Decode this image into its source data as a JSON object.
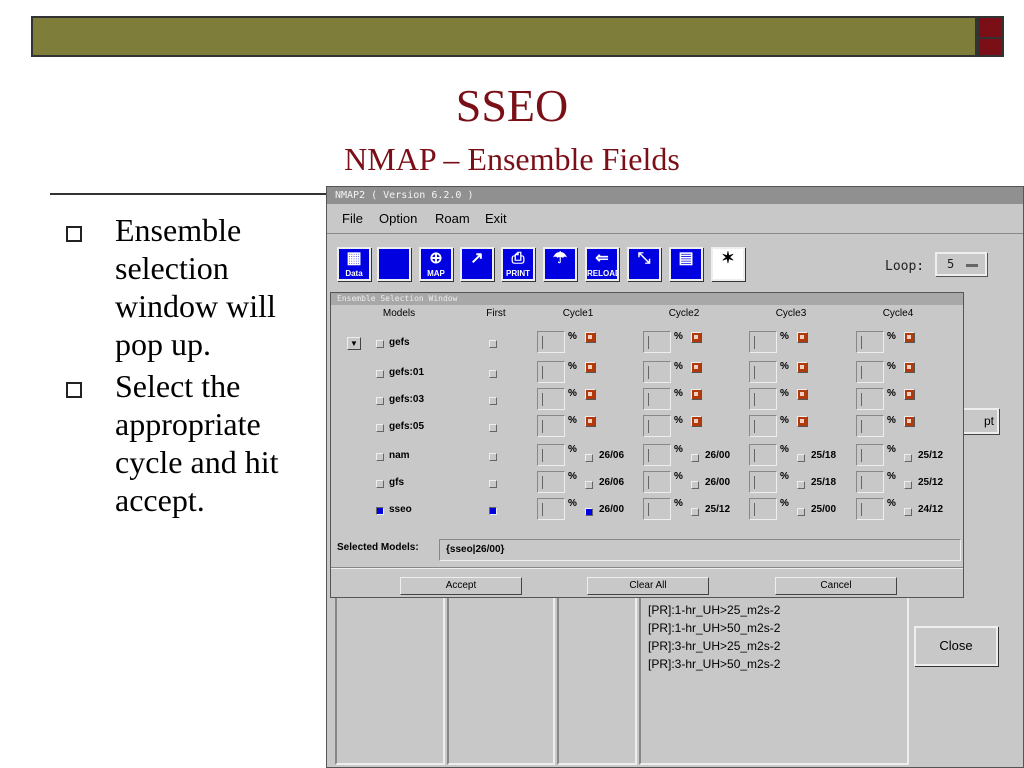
{
  "slide": {
    "title": "SSEO",
    "subtitle": "NMAP – Ensemble Fields",
    "bullets": [
      "Ensemble selection window will pop up.",
      "Select the appropriate cycle and hit accept."
    ],
    "colors": {
      "accent": "#7a0f17",
      "bar": "#7e7e3a"
    }
  },
  "nmap": {
    "title": "NMAP2 ( Version 6.2.0 )",
    "menu": [
      "File",
      "Option",
      "Roam",
      "Exit"
    ],
    "toolbar": [
      {
        "icon": "data-icon",
        "caption": "Data"
      },
      {
        "icon": "blank-icon",
        "caption": ""
      },
      {
        "icon": "map-icon",
        "caption": "MAP"
      },
      {
        "icon": "cursor-icon",
        "caption": ""
      },
      {
        "icon": "print-icon",
        "caption": "PRINT"
      },
      {
        "icon": "spray-icon",
        "caption": ""
      },
      {
        "icon": "reload-icon",
        "caption": "RELOAD"
      },
      {
        "icon": "zoom-icon",
        "caption": ""
      },
      {
        "icon": "loop-icon",
        "caption": ""
      },
      {
        "icon": "abc-icon",
        "caption": ""
      }
    ],
    "loop_label": "Loop:",
    "loop_value": "5",
    "list_items": [
      "[PR]:1-hr_UH>25_m2s-2",
      "[PR]:1-hr_UH>50_m2s-2",
      "[PR]:3-hr_UH>25_m2s-2",
      "[PR]:3-hr_UH>50_m2s-2"
    ],
    "close_label": "Close",
    "side_stub_label": "pt"
  },
  "ensemble": {
    "title": "Ensemble Selection Window",
    "headers": [
      "Models",
      "First",
      "Cycle1",
      "Cycle2",
      "Cycle3",
      "Cycle4"
    ],
    "rows": [
      {
        "model": "gefs",
        "checked": false,
        "first": false,
        "cycles": [
          {
            "type": "menu"
          },
          {
            "type": "menu"
          },
          {
            "type": "menu"
          },
          {
            "type": "menu"
          }
        ]
      },
      {
        "model": "gefs:01",
        "checked": false,
        "first": false,
        "cycles": [
          {
            "type": "menu"
          },
          {
            "type": "menu"
          },
          {
            "type": "menu"
          },
          {
            "type": "menu"
          }
        ]
      },
      {
        "model": "gefs:03",
        "checked": false,
        "first": false,
        "cycles": [
          {
            "type": "menu"
          },
          {
            "type": "menu"
          },
          {
            "type": "menu"
          },
          {
            "type": "menu"
          }
        ]
      },
      {
        "model": "gefs:05",
        "checked": false,
        "first": false,
        "cycles": [
          {
            "type": "menu"
          },
          {
            "type": "menu"
          },
          {
            "type": "menu"
          },
          {
            "type": "menu"
          }
        ]
      },
      {
        "model": "nam",
        "checked": false,
        "first": false,
        "cycles": [
          {
            "type": "check",
            "label": "26/06",
            "on": false
          },
          {
            "type": "check",
            "label": "26/00",
            "on": false
          },
          {
            "type": "check",
            "label": "25/18",
            "on": false
          },
          {
            "type": "check",
            "label": "25/12",
            "on": false
          }
        ]
      },
      {
        "model": "gfs",
        "checked": false,
        "first": false,
        "cycles": [
          {
            "type": "check",
            "label": "26/06",
            "on": false
          },
          {
            "type": "check",
            "label": "26/00",
            "on": false
          },
          {
            "type": "check",
            "label": "25/18",
            "on": false
          },
          {
            "type": "check",
            "label": "25/12",
            "on": false
          }
        ]
      },
      {
        "model": "sseo",
        "checked": true,
        "first": true,
        "cycles": [
          {
            "type": "check",
            "label": "26/00",
            "on": true
          },
          {
            "type": "check",
            "label": "25/12",
            "on": false
          },
          {
            "type": "check",
            "label": "25/00",
            "on": false
          },
          {
            "type": "check",
            "label": "24/12",
            "on": false
          }
        ]
      }
    ],
    "pct_symbol": "%",
    "selected_label": "Selected Models:",
    "selected_value": "{sseo|26/00}",
    "buttons": {
      "accept": "Accept",
      "clear": "Clear All",
      "cancel": "Cancel"
    }
  }
}
